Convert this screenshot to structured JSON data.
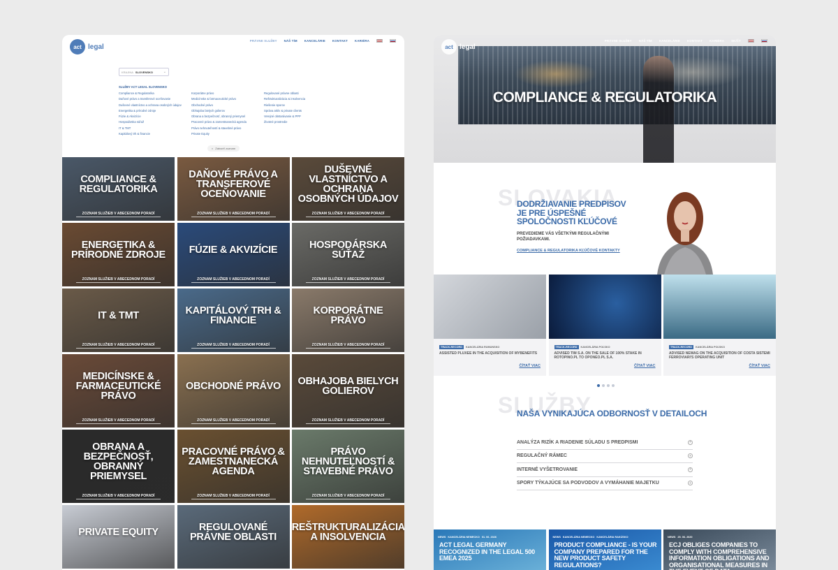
{
  "nav": {
    "logo_act": "act",
    "logo_legal": "legal",
    "items": [
      "PRÁVNE SLUŽBY",
      "NÁŠ TÍM",
      "KANCELÁRIE",
      "KONTAKT",
      "KARIÉRA"
    ]
  },
  "nav_right": {
    "search": "SK/ČT"
  },
  "filter": {
    "label": "KRAJINA",
    "value": "SLOVENSKO"
  },
  "services": {
    "heading": "SLUŽBY ACT LEGAL SLOVENSKO",
    "col1": [
      "Compliance & Regulatorika",
      "Daňové právo a transferové oceňovanie",
      "Duševné vlastníctvo a ochrana osobných údajov",
      "Energetika & prírodné zdroje",
      "Fúzie & Akvizície",
      "Hospodárska súťaž",
      "IT & TMT",
      "Kapitálový trh & financie"
    ],
    "col2": [
      "Korporátne právo",
      "Medicínske & farmaceutické právo",
      "Obchodné právo",
      "Obhajoba bielych golierov",
      "Obrana a bezpečnosť, obranný priemysel",
      "Pracovné právo & zamestnanecká agenda",
      "Právo nehnuteľností & stavebné právo",
      "Private Equity"
    ],
    "col3": [
      "Regulované právne oblasti",
      "Reštrukturalizácia & insolvencia",
      "Riešenie sporov",
      "Správa aktív & private clients",
      "Verejné obstarávanie & PPP",
      "Životné prostredie"
    ],
    "close": "Zatvoriť zoznam"
  },
  "tiles": [
    {
      "title": "Compliance & Regulatorika",
      "sub": "ZOZNAM SLUŽIEB V ABECEDNOM PORADÍ"
    },
    {
      "title": "Daňové právo a transferové oceňovanie",
      "sub": "ZOZNAM SLUŽIEB V ABECEDNOM PORADÍ"
    },
    {
      "title": "Duševné vlastníctvo a ochrana osobných údajov",
      "sub": "ZOZNAM SLUŽIEB V ABECEDNOM PORADÍ"
    },
    {
      "title": "Energetika & prírodné zdroje",
      "sub": "ZOZNAM SLUŽIEB V ABECEDNOM PORADÍ"
    },
    {
      "title": "Fúzie & Akvizície",
      "sub": "ZOZNAM SLUŽIEB V ABECEDNOM PORADÍ"
    },
    {
      "title": "Hospodárska súťaž",
      "sub": "ZOZNAM SLUŽIEB V ABECEDNOM PORADÍ"
    },
    {
      "title": "IT & TMT",
      "sub": "ZOZNAM SLUŽIEB V ABECEDNOM PORADÍ"
    },
    {
      "title": "Kapitálový trh & financie",
      "sub": "ZOZNAM SLUŽIEB V ABECEDNOM PORADÍ"
    },
    {
      "title": "Korporátne právo",
      "sub": "ZOZNAM SLUŽIEB V ABECEDNOM PORADÍ"
    },
    {
      "title": "Medicínske & farmaceutické právo",
      "sub": "ZOZNAM SLUŽIEB V ABECEDNOM PORADÍ"
    },
    {
      "title": "Obchodné právo",
      "sub": "ZOZNAM SLUŽIEB V ABECEDNOM PORADÍ"
    },
    {
      "title": "Obhajoba bielych golierov",
      "sub": "ZOZNAM SLUŽIEB V ABECEDNOM PORADÍ"
    },
    {
      "title": "Obrana a bezpečnosť, obranný priemysel",
      "sub": "ZOZNAM SLUŽIEB V ABECEDNOM PORADÍ"
    },
    {
      "title": "Pracovné právo & zamestnanecká agenda",
      "sub": "ZOZNAM SLUŽIEB V ABECEDNOM PORADÍ"
    },
    {
      "title": "Právo nehnuteľností & stavebné právo",
      "sub": "ZOZNAM SLUŽIEB V ABECEDNOM PORADÍ"
    },
    {
      "title": "Private Equity",
      "sub": ""
    },
    {
      "title": "Regulované právne oblasti",
      "sub": ""
    },
    {
      "title": "Reštrukturalizácia a insolvencia",
      "sub": ""
    }
  ],
  "tile_colors": [
    "#4a5868",
    "#7a5a40",
    "#5a4a3a",
    "#6a4a32",
    "#2a4a7a",
    "#6a6a66",
    "#6a5a48",
    "#4a6a8a",
    "#8a7a6a",
    "#6a4a38",
    "#8a7050",
    "#5a4a3a",
    "#2a2a2a",
    "#6a5030",
    "#6a7a6a",
    "#c8ccd4",
    "#5a6a7a",
    "#b06a2a"
  ],
  "hero": {
    "title": "COMPLIANCE & REGULATORIKA"
  },
  "promo": {
    "bg_word": "SLOVAKIA",
    "title": "Dodržiavanie predpisov je pre úspešné spoločnosti kľúčové",
    "sub": "Prevedieme vás všetkými regulačnými požiadavkami.",
    "link": "COMPLIANCE & REGULATORIKA KĽÚČOVÉ KONTAKTY"
  },
  "cards": [
    {
      "badge": "TRACK-RECORD",
      "office": "KANCELÁRIA RUMUNSKO",
      "title": "ASSISTED PLUXEE IN THE ACQUISITION OF MYBENEFITS",
      "more": "ČÍTAŤ VIAC"
    },
    {
      "badge": "TRACK-RECORD",
      "office": "KANCELÁRIA POĽSKO",
      "title": "ADVISED TIM S.A. ON THE SALE OF 100% STAKE IN ROTOPINO.PL TO OPONEO.PL S.A.",
      "more": "ČÍTAŤ VIAC"
    },
    {
      "badge": "TRACK-RECORD",
      "office": "KANCELÁRIA POĽSKO",
      "title": "ADVISED NEWAG ON THE ACQUISITION OF COSTA SISTEMI FERROVIARI'S OPERATING UNIT",
      "more": "ČÍTAŤ VIAC"
    }
  ],
  "expertise": {
    "bg_word": "SLUŽBY",
    "title": "NAŠA VYNIKAJÚCA ODBORNOSŤ V DETAILOCH",
    "items": [
      "ANALÝZA RIZÍK A RIADENIE SÚLADU S PREDPISMI",
      "REGULAČNÝ RÁMEC",
      "INTERNÉ VYŠETROVANIE",
      "SPORY TÝKAJÚCE SA PODVODOV A VYMÁHANIE MAJETKU"
    ]
  },
  "news": [
    {
      "tag": "NEWS",
      "office": "KANCELÁRIA NEMECKO",
      "date": "01. 06. 2026",
      "title": "ACT LEGAL GERMANY RECOGNIZED IN THE LEGAL 500 EMEA 2025"
    },
    {
      "tag": "NEWS",
      "office": "KANCELÁRIA NEMECKO",
      "date": "KANCELÁRIA RAKÚSKO",
      "title": "PRODUCT COMPLIANCE - IS YOUR COMPANY PREPARED FOR THE NEW PRODUCT SAFETY REGULATIONS?"
    },
    {
      "tag": "NEWS",
      "office": "25. 06. 2020",
      "date": "",
      "title": "ECJ OBLIGES COMPANIES TO COMPLY WITH COMPREHENSIVE INFORMATION OBLIGATIONS AND ORGANISATIONAL MEASURES IN THE EVENT OF DATA PROTECTION DELETION REQUESTS"
    }
  ]
}
